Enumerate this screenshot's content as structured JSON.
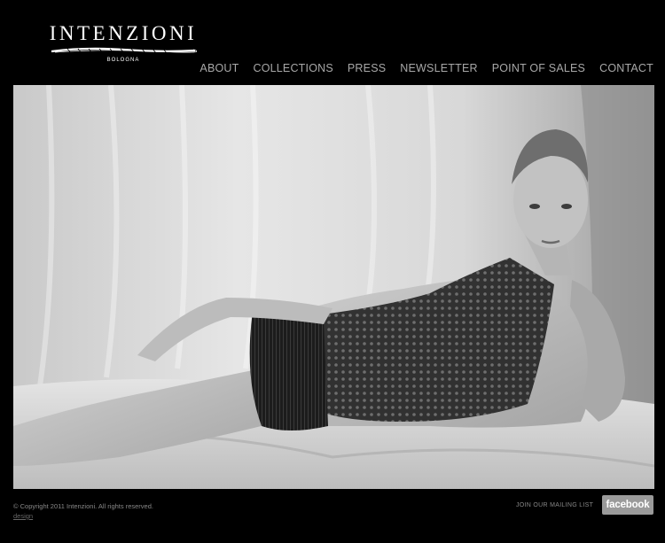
{
  "brand": {
    "name": "INTENZIONI",
    "city": "BOLOGNA"
  },
  "nav": {
    "items": [
      {
        "label": "ABOUT"
      },
      {
        "label": "COLLECTIONS"
      },
      {
        "label": "PRESS"
      },
      {
        "label": "NEWSLETTER"
      },
      {
        "label": "POINT OF SALES"
      },
      {
        "label": "CONTACT"
      }
    ]
  },
  "hero": {
    "tone": "black-and-white",
    "subject": "model in black lace body reclining on a bed"
  },
  "footer": {
    "copyright": "© Copyright 2011 Intenzioni. All rights reserved.",
    "design": "design",
    "mailing_list": "JOIN OUR MAILING LIST",
    "facebook": "facebook"
  },
  "colors": {
    "background": "#000000",
    "nav_text": "#a8a8a8",
    "facebook_button": "#9a9a9a"
  }
}
